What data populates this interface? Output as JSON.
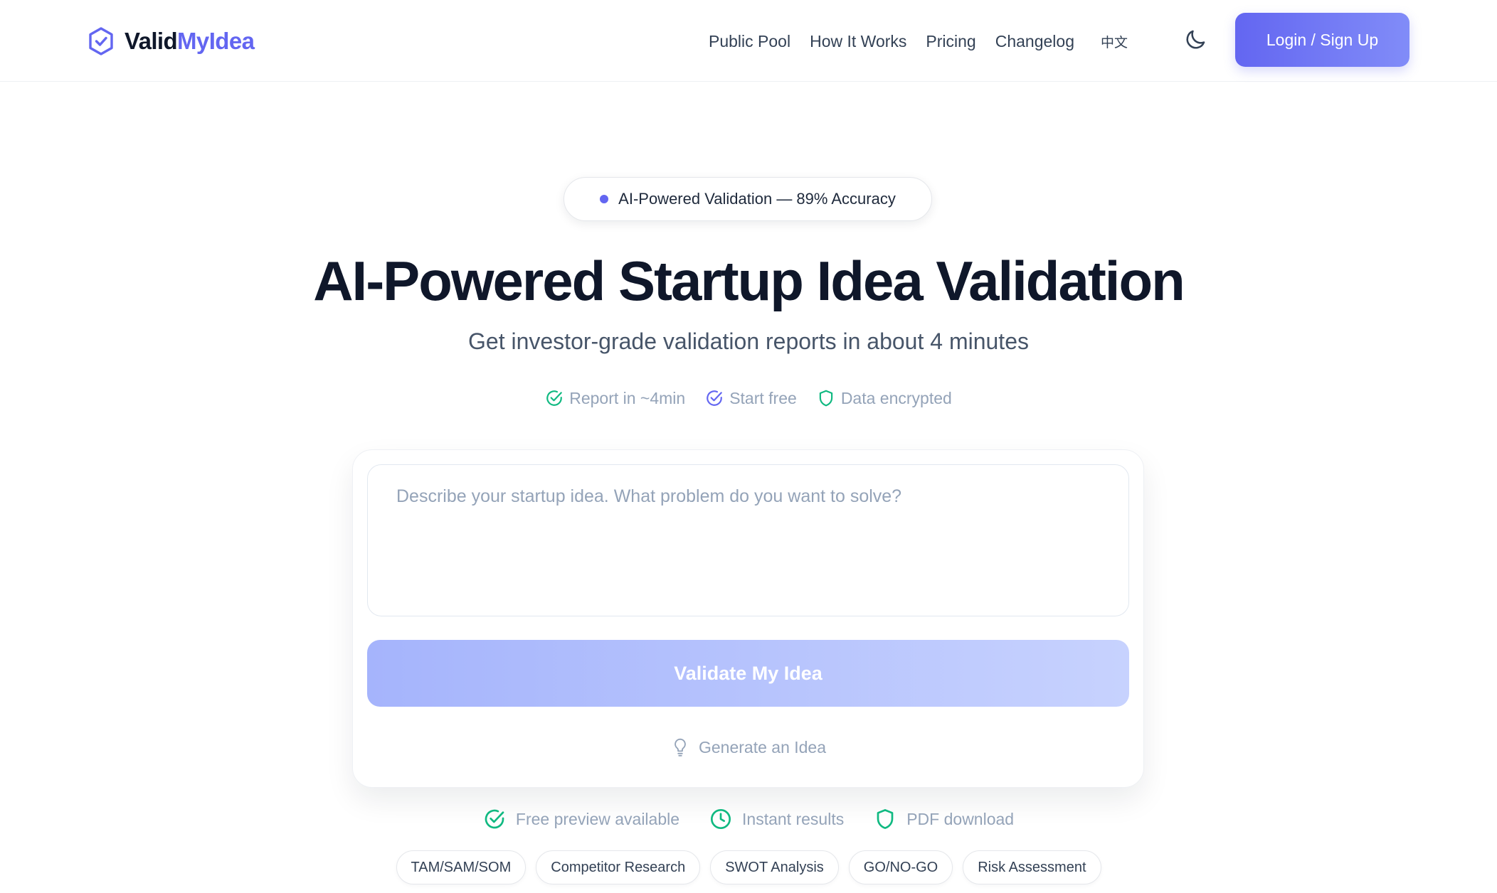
{
  "header": {
    "logo_part1": "Valid",
    "logo_part2": "MyIdea",
    "nav": [
      "Public Pool",
      "How It Works",
      "Pricing",
      "Changelog"
    ],
    "language": "中文",
    "theme_icon": "moon-icon",
    "login_label": "Login / Sign Up"
  },
  "hero": {
    "badge": "AI-Powered Validation — 89% Accuracy",
    "title": "AI-Powered Startup Idea Validation",
    "subtitle": "Get investor-grade validation reports in about 4 minutes",
    "perks": [
      "Report in ~4min",
      "Start free",
      "Data encrypted"
    ]
  },
  "form": {
    "placeholder": "Describe your startup idea. What problem do you want to solve?",
    "value": "",
    "validate_label": "Validate My Idea",
    "generate_label": "Generate an Idea"
  },
  "features": [
    "Free preview available",
    "Instant results",
    "PDF download"
  ],
  "tags": [
    "TAM/SAM/SOM",
    "Competitor Research",
    "SWOT Analysis",
    "GO/NO-GO",
    "Risk Assessment"
  ],
  "colors": {
    "accent": "#6366f1",
    "success": "#10b981",
    "text_dark": "#0f172a",
    "text_muted": "#94a3b8"
  }
}
